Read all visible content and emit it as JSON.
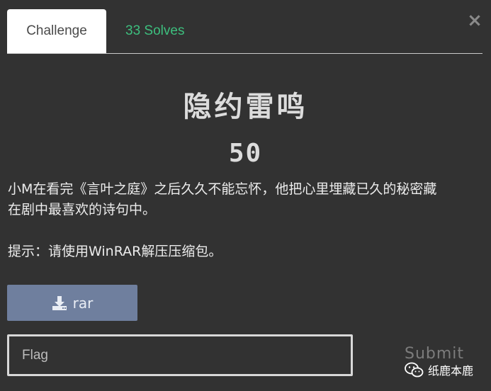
{
  "tabs": [
    {
      "label": "Challenge",
      "active": true
    },
    {
      "label": "33 Solves",
      "active": false
    }
  ],
  "close": {
    "label": "×"
  },
  "challenge": {
    "title": "隐约雷鸣",
    "points": "50",
    "description_line1": "小M在看完《言叶之庭》之后久久不能忘怀，他把心里埋藏已久的秘密藏",
    "description_line2": "在剧中最喜欢的诗句中。",
    "hint": "提示：请使用WinRAR解压压缩包。"
  },
  "download": {
    "label": "rar",
    "icon": "download-icon"
  },
  "flag": {
    "placeholder": "Flag",
    "value": ""
  },
  "submit": {
    "label": "Submit"
  },
  "watermark": {
    "text": "纸鹿本鹿",
    "icon": "wechat-icon"
  },
  "colors": {
    "background": "#323232",
    "solves_green": "#3dbf7e",
    "download_button": "#6f7f9e"
  }
}
